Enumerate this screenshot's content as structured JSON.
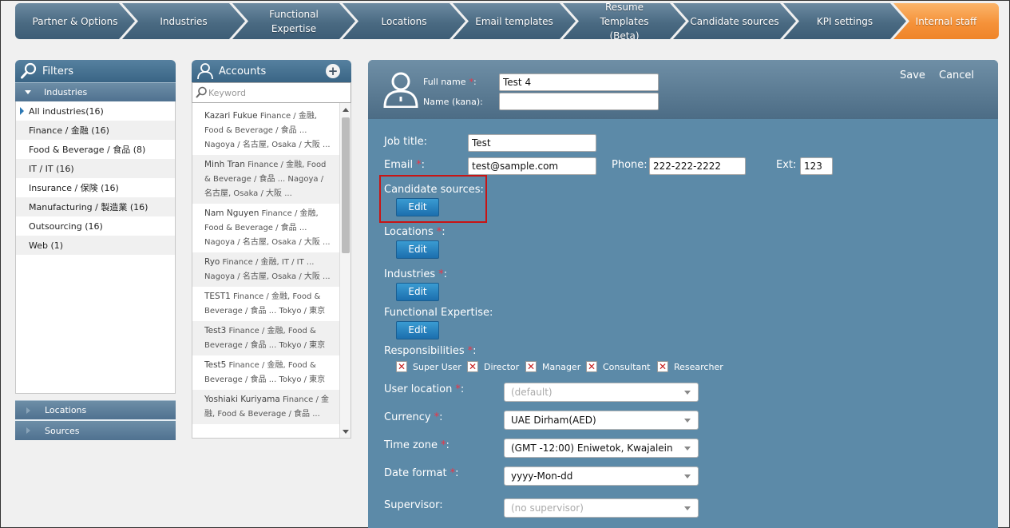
{
  "wizard": {
    "steps": [
      {
        "label": "Partner & Options"
      },
      {
        "label": "Industries"
      },
      {
        "label": "Functional Expertise"
      },
      {
        "label": "Locations"
      },
      {
        "label": "Email templates"
      },
      {
        "label": "Resume Templates (Beta)"
      },
      {
        "label": "Candidate sources"
      },
      {
        "label": "KPI settings"
      },
      {
        "label": "Internal staff"
      }
    ],
    "active_step": "Internal staff",
    "colors": {
      "step": "#4a6a82",
      "active": "#f5923a"
    }
  },
  "filters": {
    "title": "Filters",
    "industries_label": "Industries",
    "industries": [
      {
        "label": "All industries(16)"
      },
      {
        "label": "Finance / 金融 (16)"
      },
      {
        "label": "Food & Beverage / 食品 (8)"
      },
      {
        "label": "IT / IT (16)"
      },
      {
        "label": "Insurance / 保険 (16)"
      },
      {
        "label": "Manufacturing / 製造業 (16)"
      },
      {
        "label": "Outsourcing (16)"
      },
      {
        "label": "Web (1)"
      }
    ],
    "locations_label": "Locations",
    "sources_label": "Sources"
  },
  "accounts": {
    "title": "Accounts",
    "add_symbol": "+",
    "search_placeholder": "Keyword",
    "rows": [
      {
        "name": "Kazari Fukue",
        "l1": " Finance / 金融,",
        "l2": "Food & Beverage / 食品 ...",
        "l3": "Nagoya / 名古屋, Osaka / 大阪 ..."
      },
      {
        "name": "Minh Tran",
        "l1": " Finance / 金融, Food",
        "l2": "& Beverage / 食品 ...   Nagoya /",
        "l3": "名古屋, Osaka / 大阪 ..."
      },
      {
        "name": "Nam Nguyen",
        "l1": " Finance / 金融,",
        "l2": "Food & Beverage / 食品 ...",
        "l3": "Nagoya / 名古屋, Osaka / 大阪 ..."
      },
      {
        "name": "Ryo",
        "l1": " Finance / 金融, IT / IT ...",
        "l2": "Nagoya / 名古屋, Osaka / 大阪 ...",
        "l3": ""
      },
      {
        "name": "TEST1",
        "l1": " Finance / 金融, Food &",
        "l2": "Beverage / 食品 ...   Tokyo / 東京",
        "l3": ""
      },
      {
        "name": "Test3",
        "l1": " Finance / 金融, Food &",
        "l2": "Beverage / 食品 ...   Tokyo / 東京",
        "l3": ""
      },
      {
        "name": "Test5",
        "l1": " Finance / 金融, Food &",
        "l2": "Beverage / 食品 ...   Tokyo / 東京",
        "l3": ""
      },
      {
        "name": "Yoshiaki Kuriyama",
        "l1": " Finance / 金",
        "l2": "融, Food & Beverage / 食品 ...",
        "l3": ""
      }
    ]
  },
  "detail": {
    "save_label": "Save",
    "cancel_label": "Cancel",
    "full_name_label": "Full name",
    "full_name_value": "Test 4",
    "name_kana_label": "Name (kana):",
    "name_kana_value": "",
    "job_title_label": "Job title:",
    "job_title_value": "Test",
    "email_label": "Email",
    "email_value": "test@sample.com",
    "phone_label": "Phone:",
    "phone_value": "222-222-2222",
    "ext_label": "Ext:",
    "ext_value": "123",
    "candidate_sources_label": "Candidate sources:",
    "locations_label": "Locations",
    "industries_label": "Industries",
    "functional_expertise_label": "Functional Expertise:",
    "edit_label": "Edit",
    "responsibilities_label": "Responsibilities",
    "responsibilities": [
      {
        "label": "Super User",
        "checked": true
      },
      {
        "label": "Director",
        "checked": true
      },
      {
        "label": "Manager",
        "checked": true
      },
      {
        "label": "Consultant",
        "checked": true
      },
      {
        "label": "Researcher",
        "checked": true
      }
    ],
    "checkbox_mark": "✕",
    "required_mark": "*",
    "colon": ":",
    "user_location_label": "User location",
    "user_location_value": "(default)",
    "currency_label": "Currency",
    "currency_value": "UAE Dirham(AED)",
    "time_zone_label": "Time zone",
    "time_zone_value": "(GMT -12:00) Eniwetok, Kwajalein",
    "date_format_label": "Date format",
    "date_format_value": "yyyy-Mon-dd",
    "supervisor_label": "Supervisor:",
    "supervisor_value": "(no supervisor)",
    "colors": {
      "panel": "#5c8aa8",
      "edit_button": "#1c6fae",
      "highlight": "#c81414",
      "required": "#e34"
    }
  }
}
